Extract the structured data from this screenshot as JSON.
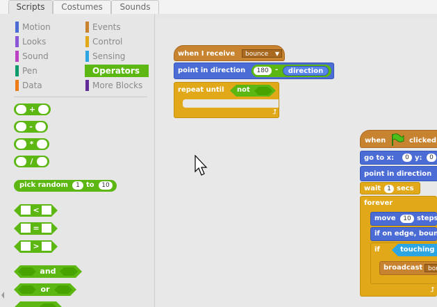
{
  "tabs": [
    {
      "label": "Scripts",
      "active": true
    },
    {
      "label": "Costumes",
      "active": false
    },
    {
      "label": "Sounds",
      "active": false
    }
  ],
  "categories": [
    {
      "label": "Motion",
      "color": "#4a6cd4"
    },
    {
      "label": "Events",
      "color": "#c88330"
    },
    {
      "label": "Looks",
      "color": "#8a55d7"
    },
    {
      "label": "Control",
      "color": "#e1a91a"
    },
    {
      "label": "Sound",
      "color": "#bb42c3"
    },
    {
      "label": "Sensing",
      "color": "#2ca5e2"
    },
    {
      "label": "Pen",
      "color": "#0e9a6c"
    },
    {
      "label": "Operators",
      "color": "#5cb712",
      "selected": true
    },
    {
      "label": "Data",
      "color": "#ee7d16"
    },
    {
      "label": "More Blocks",
      "color": "#632d99"
    }
  ],
  "palette": {
    "ops": [
      "+",
      "-",
      "*",
      "/"
    ],
    "pick_random": {
      "label_a": "pick random",
      "from": "1",
      "label_b": "to",
      "to": "10"
    },
    "compare": [
      "<",
      "=",
      ">"
    ],
    "and_label": "and",
    "or_label": "or"
  },
  "script1": {
    "hat_label": "when I receive",
    "message": "bounce",
    "point_label": "point in direction",
    "num": "180",
    "minus": "-",
    "reporter": "direction",
    "repeat_label": "repeat until",
    "not_label": "not"
  },
  "script2": {
    "hat_when": "when",
    "hat_clicked": "clicked",
    "goto_label_a": "go to x:",
    "x": "0",
    "goto_label_b": "y:",
    "y": "0",
    "point_label": "point in direction",
    "wait_label_a": "wait",
    "wait_num": "1",
    "wait_label_b": "secs",
    "forever_label": "forever",
    "move_label_a": "move",
    "move_num": "10",
    "move_label_b": "steps",
    "bounce_label": "if on edge, bounce",
    "if_label": "if",
    "touching_label": "touching",
    "broadcast_label": "broadcast",
    "broadcast_value": "bounce"
  }
}
